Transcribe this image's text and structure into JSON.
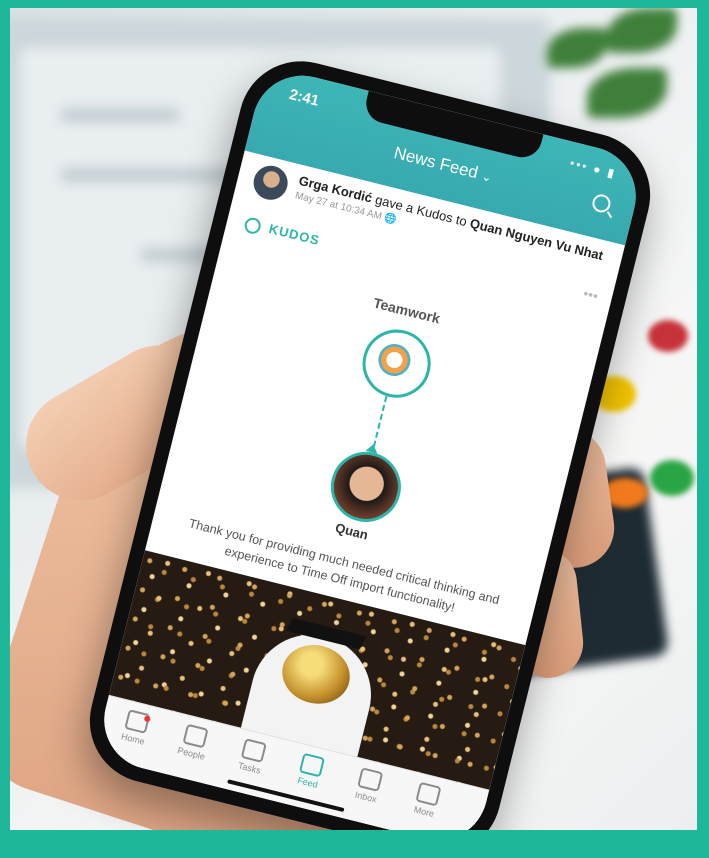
{
  "status_bar": {
    "time": "2:41",
    "indicators": "••• ● ▮"
  },
  "header": {
    "title": "News Feed",
    "chevron": "⌄",
    "search_icon": "search-icon"
  },
  "post": {
    "author": "Grga Kordić",
    "action": "gave a Kudos to",
    "recipient": "Quan Nguyen Vu Nhat",
    "timestamp": "May 27 at 10:34 AM",
    "more": "•••"
  },
  "kudos": {
    "label": "KUDOS",
    "category": "Teamwork",
    "recipient_short": "Quan",
    "message": "Thank you for providing much needed critical thinking and experience to Time Off import functionality!"
  },
  "tabs": [
    {
      "label": "Home",
      "icon": "home-icon",
      "active": false
    },
    {
      "label": "People",
      "icon": "people-icon",
      "active": false
    },
    {
      "label": "Tasks",
      "icon": "tasks-icon",
      "active": false
    },
    {
      "label": "Feed",
      "icon": "feed-icon",
      "active": true
    },
    {
      "label": "Inbox",
      "icon": "inbox-icon",
      "active": false
    },
    {
      "label": "More",
      "icon": "more-icon",
      "active": false
    }
  ],
  "colors": {
    "accent": "#2bb6a9",
    "header": "#3db6b7",
    "background": "#1fb79a"
  }
}
